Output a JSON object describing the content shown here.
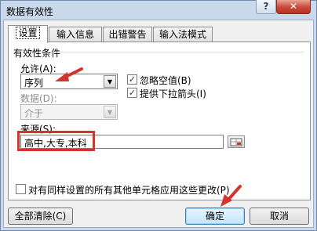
{
  "window": {
    "title": "数据有效性",
    "help_glyph": "?",
    "close_glyph": "✕"
  },
  "tabs": [
    {
      "label": "设置",
      "active": true
    },
    {
      "label": "输入信息",
      "active": false
    },
    {
      "label": "出错警告",
      "active": false
    },
    {
      "label": "输入法模式",
      "active": false
    }
  ],
  "settings": {
    "group_label": "有效性条件",
    "allow_label": "允许(A):",
    "allow_value": "序列",
    "data_label": "数据(D):",
    "data_value": "介于",
    "ignore_blank_label": "忽略空值(B)",
    "ignore_blank_checked": true,
    "dropdown_label": "提供下拉箭头(I)",
    "dropdown_checked": true,
    "source_label": "来源(S):",
    "source_value": "高中,大专,本科",
    "apply_all_label": "对有同样设置的所有其他单元格应用这些更改(P)",
    "apply_all_checked": false
  },
  "buttons": {
    "clear_all": "全部清除(C)",
    "ok": "确定",
    "cancel": "取消"
  },
  "annotation_color": "#d2342e"
}
